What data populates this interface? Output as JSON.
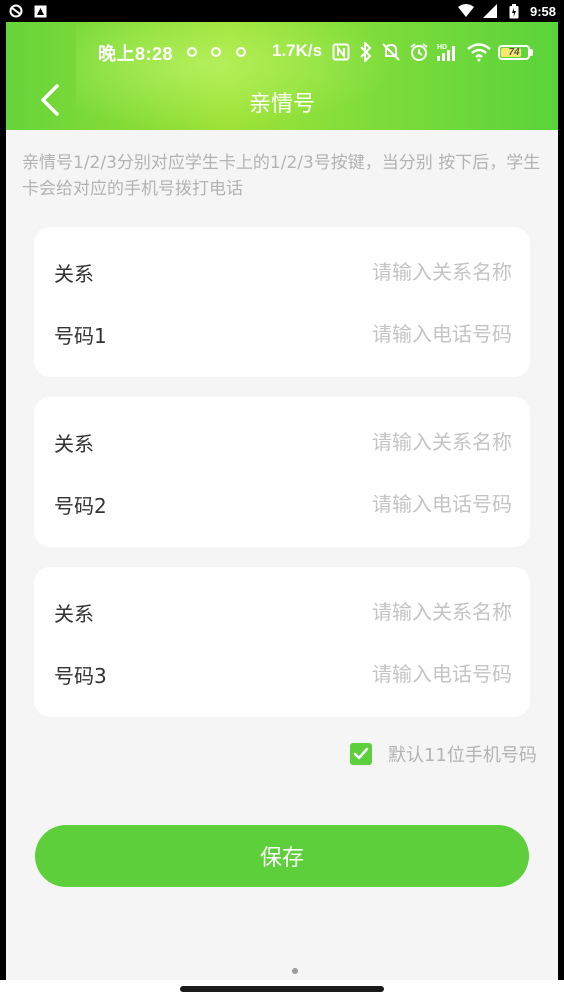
{
  "system_bar": {
    "time": "9:58"
  },
  "inner_status": {
    "time": "晚上8:28",
    "net_speed": "1.7K/s",
    "battery": "74",
    "hd_label": "HD"
  },
  "nav": {
    "title": "亲情号"
  },
  "hint": "亲情号1/2/3分别对应学生卡上的1/2/3号按键，当分别 按下后，学生卡会给对应的手机号拨打电话",
  "cards": [
    {
      "relation_label": "关系",
      "relation_placeholder": "请输入关系名称",
      "number_label": "号码1",
      "number_placeholder": "请输入电话号码"
    },
    {
      "relation_label": "关系",
      "relation_placeholder": "请输入关系名称",
      "number_label": "号码2",
      "number_placeholder": "请输入电话号码"
    },
    {
      "relation_label": "关系",
      "relation_placeholder": "请输入关系名称",
      "number_label": "号码3",
      "number_placeholder": "请输入电话号码"
    }
  ],
  "default_option": {
    "label": "默认11位手机号码",
    "checked": true
  },
  "save_label": "保存",
  "colors": {
    "accent": "#5ccf3a",
    "header_light": "#9ee235",
    "background": "#f5f5f5",
    "hint_text": "#b3b3b3"
  }
}
